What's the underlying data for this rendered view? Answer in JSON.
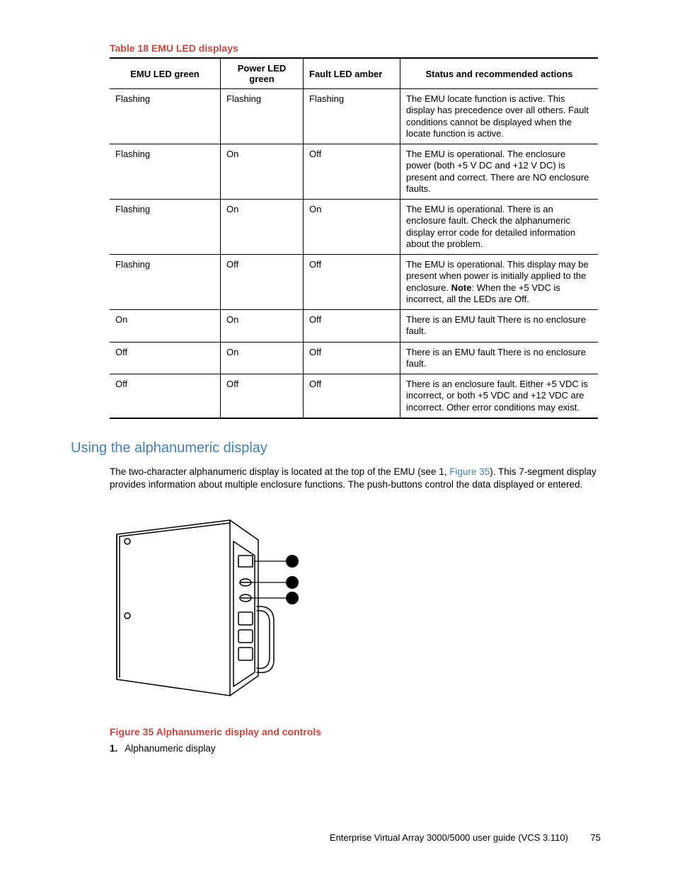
{
  "table": {
    "caption": "Table 18 EMU LED displays",
    "headers": [
      "EMU LED green",
      "Power LED green",
      "Fault LED amber",
      "Status and recommended actions"
    ],
    "rows": [
      {
        "c1": "Flashing",
        "c2": "Flashing",
        "c3": "Flashing",
        "c4": "The EMU locate function is active. This display has precedence over all others. Fault conditions cannot be displayed when the locate function is active."
      },
      {
        "c1": "Flashing",
        "c2": "On",
        "c3": "Off",
        "c4": "The EMU is operational. The enclosure power (both +5 V DC and +12 V DC) is present and correct. There are NO enclosure faults."
      },
      {
        "c1": "Flashing",
        "c2": "On",
        "c3": "On",
        "c4": "The EMU is operational. There is an enclosure fault. Check the alphanumeric display error code for detailed information about the problem."
      },
      {
        "c1": "Flashing",
        "c2": "Off",
        "c3": "Off",
        "c4_pre": "The EMU is operational. This display may be present when power is initially applied to the enclosure. ",
        "c4_bold": "Note",
        "c4_post": ": When the +5 VDC is incorrect, all the LEDs are Off."
      },
      {
        "c1": "On",
        "c2": "On",
        "c3": "Off",
        "c4": "There is an EMU fault There is no enclosure fault."
      },
      {
        "c1": "Off",
        "c2": "On",
        "c3": "Off",
        "c4": "There is an EMU fault There is no enclosure fault."
      },
      {
        "c1": "Off",
        "c2": "Off",
        "c3": "Off",
        "c4": "There is an enclosure fault. Either +5 VDC is incorrect, or both +5 VDC and +12 VDC are incorrect. Other error conditions may exist."
      }
    ]
  },
  "section": {
    "heading": "Using the alphanumeric display",
    "para_pre": "The two-character alphanumeric display is located at the top of the EMU (see 1, ",
    "para_link": "Figure 35",
    "para_post": "). This 7-segment display provides information about multiple enclosure functions. The push-buttons control the data displayed or entered."
  },
  "figure": {
    "caption": "Figure 35 Alphanumeric display and controls",
    "legend_num": "1.",
    "legend_text": "Alphanumeric display"
  },
  "footer": {
    "title": "Enterprise Virtual Array 3000/5000 user guide (VCS 3.110)",
    "page": "75"
  }
}
